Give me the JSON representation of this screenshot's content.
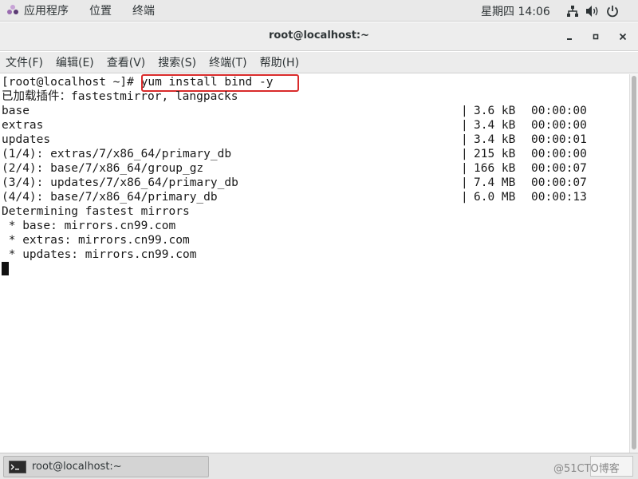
{
  "topbar": {
    "applications_label": "应用程序",
    "places_label": "位置",
    "terminal_label": "终端",
    "clock": "星期四 14:06",
    "icons": [
      "network-icon",
      "volume-icon",
      "power-icon"
    ]
  },
  "window": {
    "title": "root@localhost:~",
    "buttons": [
      "minimize-icon",
      "maximize-icon",
      "close-icon"
    ]
  },
  "menubar": {
    "items": [
      "文件(F)",
      "编辑(E)",
      "查看(V)",
      "搜索(S)",
      "终端(T)",
      "帮助(H)"
    ]
  },
  "terminal": {
    "prompt": "[root@localhost ~]# ",
    "command": "yum install bind -y",
    "highlight_color": "#d92b2b",
    "plugins_line": "已加载插件：fastestmirror, langpacks",
    "repos": [
      {
        "name": "base",
        "sep": "|",
        "size": "3.6 kB",
        "time": "00:00:00"
      },
      {
        "name": "extras",
        "sep": "|",
        "size": "3.4 kB",
        "time": "00:00:00"
      },
      {
        "name": "updates",
        "sep": "|",
        "size": "3.4 kB",
        "time": "00:00:01"
      },
      {
        "name": "(1/4): extras/7/x86_64/primary_db",
        "sep": "|",
        "size": "215 kB",
        "time": "00:00:00"
      },
      {
        "name": "(2/4): base/7/x86_64/group_gz",
        "sep": "|",
        "size": "166 kB",
        "time": "00:00:07"
      },
      {
        "name": "(3/4): updates/7/x86_64/primary_db",
        "sep": "|",
        "size": "7.4 MB",
        "time": "00:00:07"
      },
      {
        "name": "(4/4): base/7/x86_64/primary_db",
        "sep": "|",
        "size": "6.0 MB",
        "time": "00:00:13"
      }
    ],
    "mirrors_header": "Determining fastest mirrors",
    "mirrors": [
      " * base: mirrors.cn99.com",
      " * extras: mirrors.cn99.com",
      " * updates: mirrors.cn99.com"
    ]
  },
  "taskbar": {
    "task_label": "root@localhost:~",
    "watermark": "@51CTO博客"
  }
}
